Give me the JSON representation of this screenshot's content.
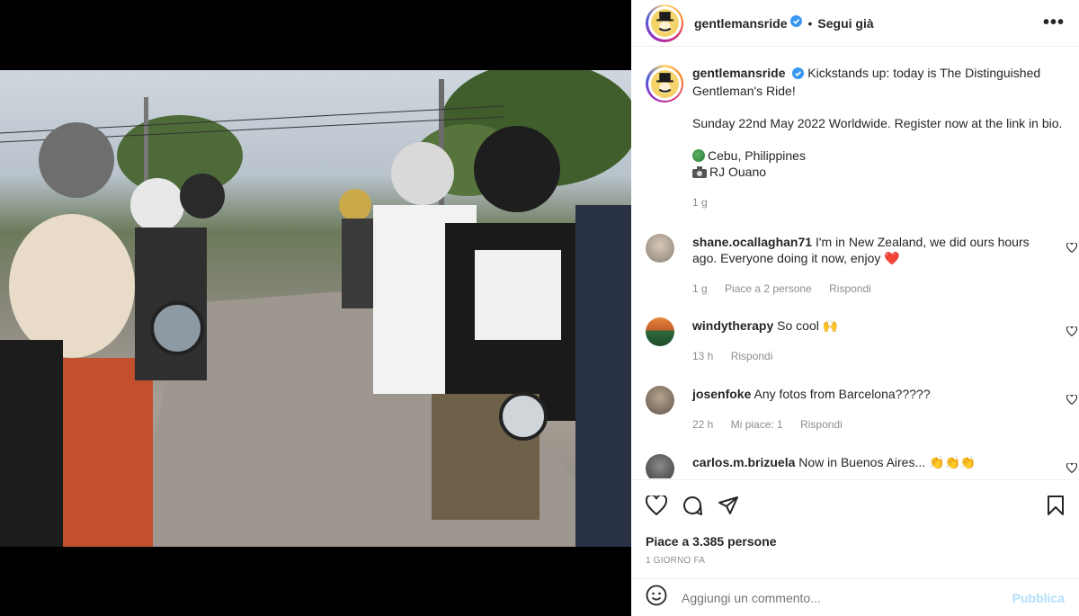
{
  "post": {
    "username": "gentlemansride",
    "follow_label": "Segui già",
    "more_label": "•••",
    "caption": {
      "line1": "Kickstands up: today is The Distinguished Gentleman's Ride!",
      "line2": "Sunday 22nd May 2022 Worldwide. Register now at the link in bio.",
      "location": "Cebu, Philippines",
      "credit": "RJ Ouano",
      "age": "1 g"
    },
    "comments": [
      {
        "user": "shane.ocallaghan71",
        "text": "I'm in New Zealand, we did ours hours ago. Everyone doing it now, enjoy ❤️",
        "age": "1 g",
        "likes": "Piace a 2 persone",
        "reply": "Rispondi"
      },
      {
        "user": "windytherapy",
        "text": "So cool 🙌",
        "age": "13 h",
        "reply": "Rispondi"
      },
      {
        "user": "josenfoke",
        "text": "Any fotos from Barcelona?????",
        "age": "22 h",
        "likes": "Mi piace: 1",
        "reply": "Rispondi"
      },
      {
        "user": "carlos.m.brizuela",
        "text": "Now in Buenos Aires... 👏👏👏"
      }
    ],
    "likes_text": "Piace a 3.385 persone",
    "timestamp": "1 GIORNO FA",
    "comment_placeholder": "Aggiungi un commento...",
    "publish_label": "Pubblica",
    "icons": [
      "heart-icon",
      "comment-icon",
      "share-icon",
      "bookmark-icon",
      "emoji-icon",
      "verified-icon",
      "globe-icon",
      "camera-icon"
    ],
    "colors": {
      "verified": "#3897f0",
      "publish": "#b2dffc",
      "meta": "#8e8e8e",
      "heart_red": "#ed4956"
    }
  }
}
